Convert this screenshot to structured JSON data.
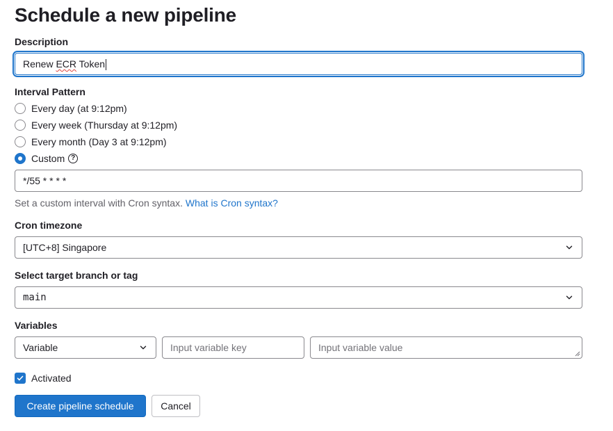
{
  "page": {
    "title": "Schedule a new pipeline"
  },
  "description": {
    "label": "Description",
    "value_prefix": "Renew ",
    "value_misspelled": "ECR",
    "value_suffix": " Token"
  },
  "interval": {
    "label": "Interval Pattern",
    "options": [
      {
        "label": "Every day (at 9:12pm)",
        "checked": false
      },
      {
        "label": "Every week (Thursday at 9:12pm)",
        "checked": false
      },
      {
        "label": "Every month (Day 3 at 9:12pm)",
        "checked": false
      },
      {
        "label": "Custom",
        "checked": true
      }
    ],
    "custom_value": "*/55 * * * *",
    "help_text": "Set a custom interval with Cron syntax.",
    "help_link": "What is Cron syntax?"
  },
  "timezone": {
    "label": "Cron timezone",
    "value": "[UTC+8] Singapore"
  },
  "target_branch": {
    "label": "Select target branch or tag",
    "value": "main"
  },
  "variables": {
    "label": "Variables",
    "type_value": "Variable",
    "key_placeholder": "Input variable key",
    "value_placeholder": "Input variable value"
  },
  "activated": {
    "label": "Activated",
    "checked": true
  },
  "actions": {
    "create_label": "Create pipeline schedule",
    "cancel_label": "Cancel"
  },
  "colors": {
    "primary": "#1f75cb",
    "border": "#89888d",
    "text": "#1f1e24",
    "help_text": "#626168",
    "misspelling": "#e0443b"
  }
}
